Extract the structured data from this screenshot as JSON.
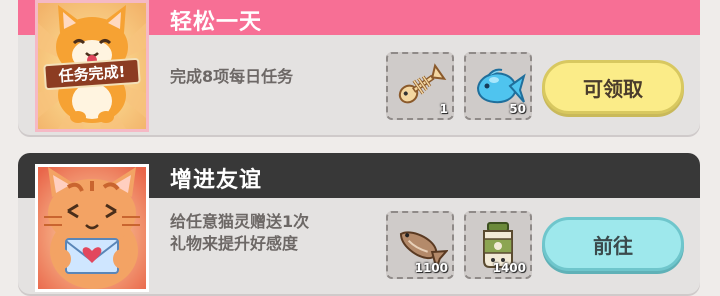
{
  "tasks": [
    {
      "title": "轻松一天",
      "description_lines": [
        "完成8项每日任务"
      ],
      "badge": "任务完成!",
      "rewards": [
        {
          "icon": "fish-bone-icon",
          "qty": "1"
        },
        {
          "icon": "blue-fish-icon",
          "qty": "50"
        }
      ],
      "button": "可领取",
      "header_color": "#f76f95"
    },
    {
      "title": "增进友谊",
      "description_lines": [
        "给任意猫灵赠送1次",
        "礼物来提升好感度"
      ],
      "rewards": [
        {
          "icon": "dried-fish-icon",
          "qty": "1100"
        },
        {
          "icon": "cat-food-jar-icon",
          "qty": "1400"
        }
      ],
      "button": "前往",
      "header_color": "#383838"
    }
  ]
}
